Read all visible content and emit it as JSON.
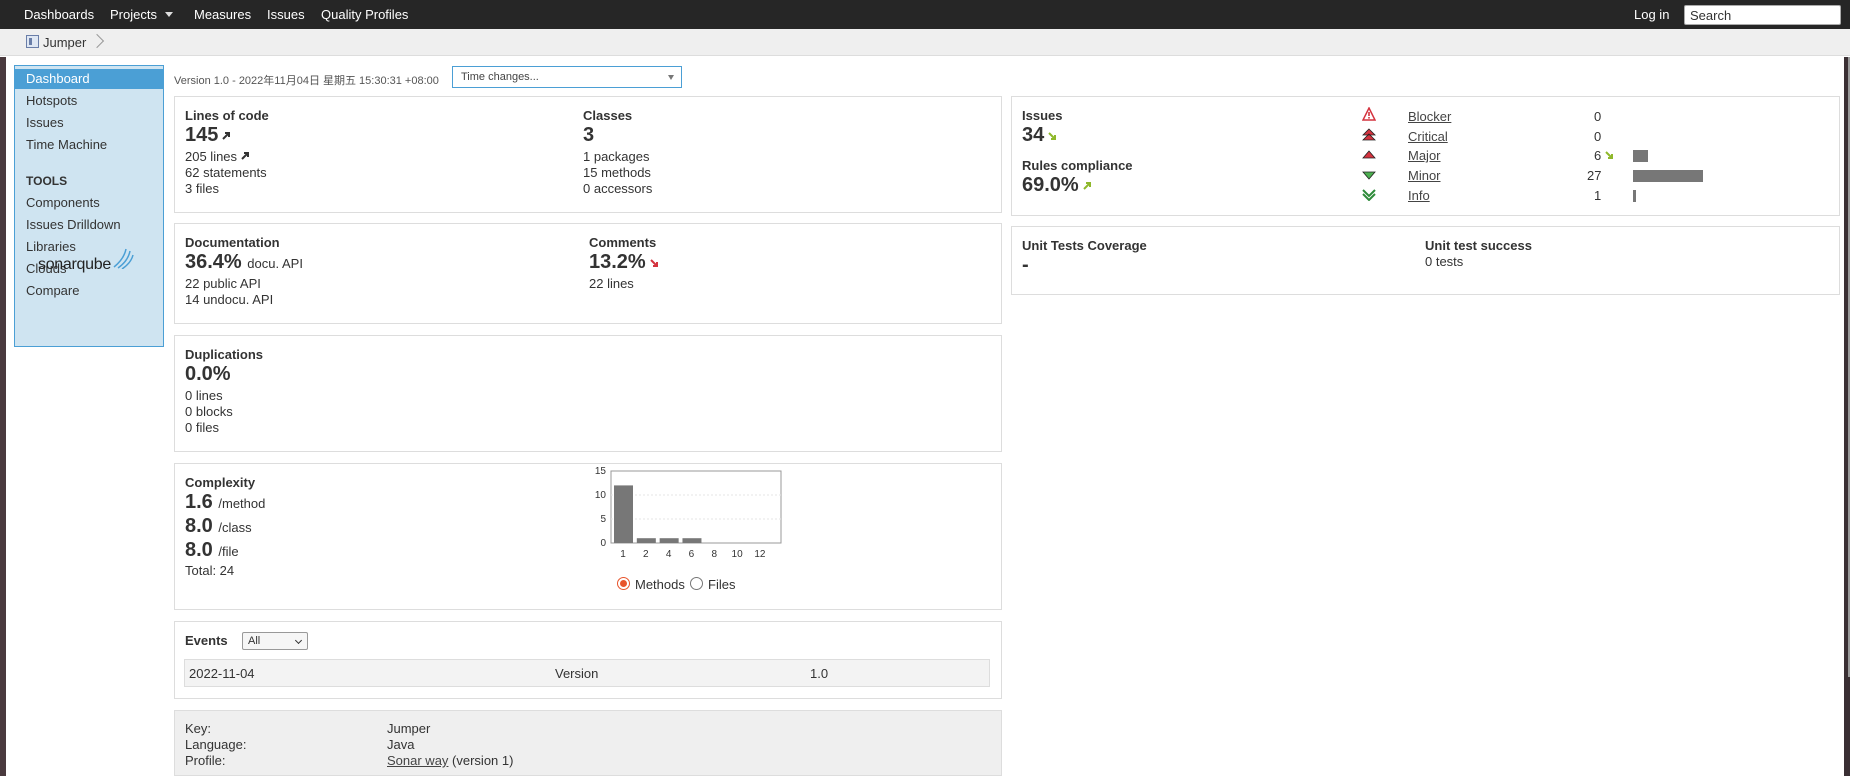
{
  "topnav": {
    "dashboards": "Dashboards",
    "projects": "Projects",
    "measures": "Measures",
    "issues": "Issues",
    "quality_profiles": "Quality Profiles",
    "login": "Log in",
    "search_placeholder": "Search"
  },
  "breadcrumb": {
    "project": "Jumper"
  },
  "sidebar": {
    "items": [
      "Dashboard",
      "Hotspots",
      "Issues",
      "Time Machine"
    ],
    "tools_heading": "TOOLS",
    "tools": [
      "Components",
      "Issues Drilldown",
      "Libraries",
      "Clouds",
      "Compare"
    ],
    "logo_text": "sonarqube"
  },
  "header": {
    "version_line": "Version 1.0 - 2022年11月04日 星期五 15:30:31 +08:00",
    "time_changes": "Time changes..."
  },
  "size": {
    "loc_title": "Lines of code",
    "loc_value": "145",
    "lines": "205 lines",
    "statements": "62 statements",
    "files": "3 files",
    "classes_title": "Classes",
    "classes_value": "3",
    "packages": "1 packages",
    "methods": "15 methods",
    "accessors": "0 accessors"
  },
  "documentation": {
    "title": "Documentation",
    "value": "36.4%",
    "unit": "docu. API",
    "public_api": "22 public API",
    "undocu_api": "14 undocu. API",
    "comments_title": "Comments",
    "comments_value": "13.2%",
    "comment_lines": "22 lines"
  },
  "duplications": {
    "title": "Duplications",
    "value": "0.0%",
    "lines": "0 lines",
    "blocks": "0 blocks",
    "files": "0 files"
  },
  "complexity": {
    "title": "Complexity",
    "per_method": "1.6",
    "per_method_unit": "/method",
    "per_class": "8.0",
    "per_class_unit": "/class",
    "per_file": "8.0",
    "per_file_unit": "/file",
    "total": "Total: 24",
    "methods_label": "Methods",
    "files_label": "Files"
  },
  "chart_data": {
    "type": "bar",
    "categories": [
      "1",
      "2",
      "4",
      "6",
      "8",
      "10",
      "12"
    ],
    "values": [
      12,
      1,
      1,
      1,
      0,
      0,
      0
    ],
    "xticks": [
      "1",
      "2",
      "4",
      "6",
      "8",
      "10",
      "12"
    ],
    "yticks": [
      "0",
      "5",
      "10",
      "15"
    ],
    "ylim": [
      0,
      15
    ],
    "title": "",
    "xlabel": "",
    "ylabel": "",
    "grid": true
  },
  "events": {
    "title": "Events",
    "filter": "All",
    "row": {
      "date": "2022-11-04",
      "type": "Version",
      "name": "1.0"
    }
  },
  "project_info": {
    "key_label": "Key:",
    "key": "Jumper",
    "language_label": "Language:",
    "language": "Java",
    "profile_label": "Profile:",
    "profile": "Sonar way",
    "profile_version": "(version 1)"
  },
  "issues": {
    "title": "Issues",
    "value": "34",
    "rules_title": "Rules compliance",
    "rules_value": "69.0%",
    "severities": [
      {
        "label": "Blocker",
        "count": "0",
        "fraction": 0
      },
      {
        "label": "Critical",
        "count": "0",
        "fraction": 0
      },
      {
        "label": "Major",
        "count": "6",
        "fraction": 0.22
      },
      {
        "label": "Minor",
        "count": "27",
        "fraction": 1.0
      },
      {
        "label": "Info",
        "count": "1",
        "fraction": 0.04
      }
    ]
  },
  "tests": {
    "coverage_title": "Unit Tests Coverage",
    "coverage_value": "-",
    "success_title": "Unit test success",
    "success_value": "0 tests"
  },
  "colors": {
    "topbar": "#262626",
    "accent": "#4b9fd5",
    "sidebar_bg": "#cfe4f1",
    "good_arrow": "#8fb82b",
    "bad_arrow": "#d4333f",
    "bar": "#777777"
  }
}
